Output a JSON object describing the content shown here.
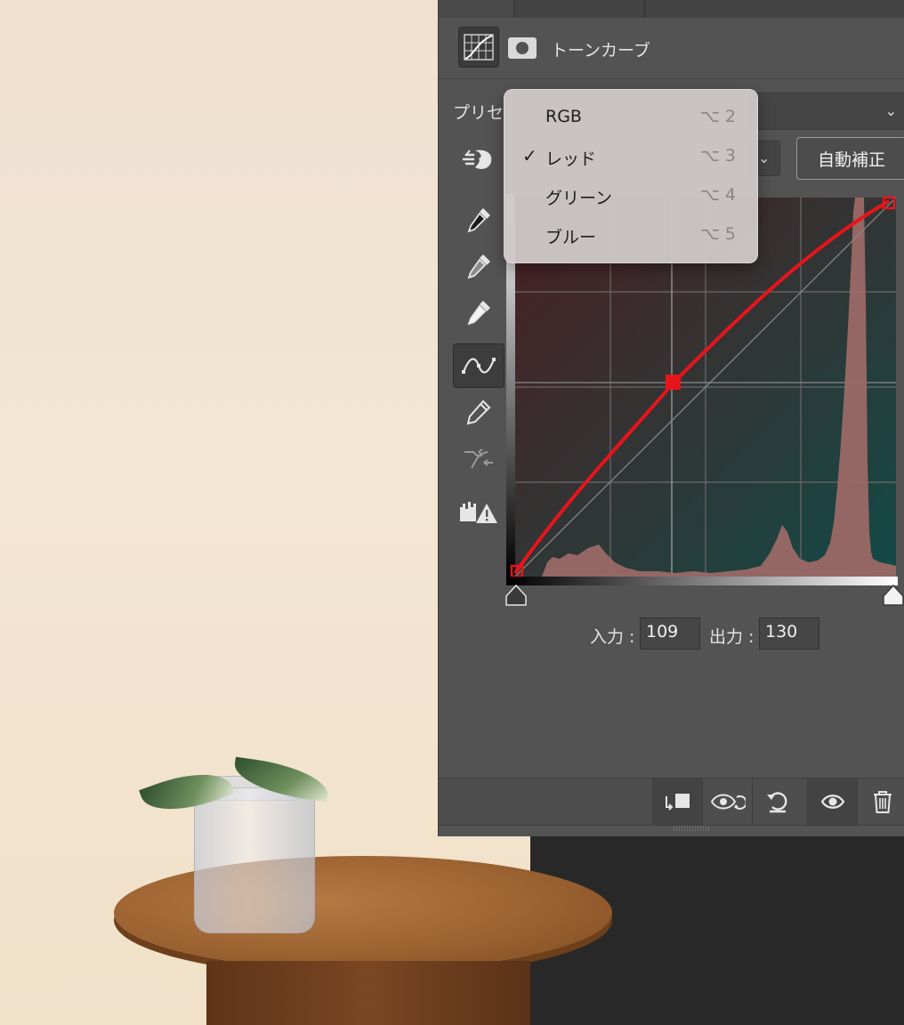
{
  "panel": {
    "title": "トーンカーブ",
    "preset_label": "プリセ",
    "auto_button_label": "自動補正"
  },
  "channel_menu": {
    "items": [
      {
        "label": "RGB",
        "shortcut": "⌥ 2",
        "checked": false
      },
      {
        "label": "レッド",
        "shortcut": "⌥ 3",
        "checked": true
      },
      {
        "label": "グリーン",
        "shortcut": "⌥ 4",
        "checked": false
      },
      {
        "label": "ブルー",
        "shortcut": "⌥ 5",
        "checked": false
      }
    ],
    "check_glyph": "✓"
  },
  "io": {
    "input_label": "入力 :",
    "input_value": "109",
    "output_label": "出力 :",
    "output_value": "130"
  },
  "icons": {
    "preset_chevron": "⌄",
    "channel_chevron": "⌄"
  },
  "colors": {
    "curve": "#e8141b",
    "panel_bg": "#535353",
    "histogram": "#9b6966"
  }
}
